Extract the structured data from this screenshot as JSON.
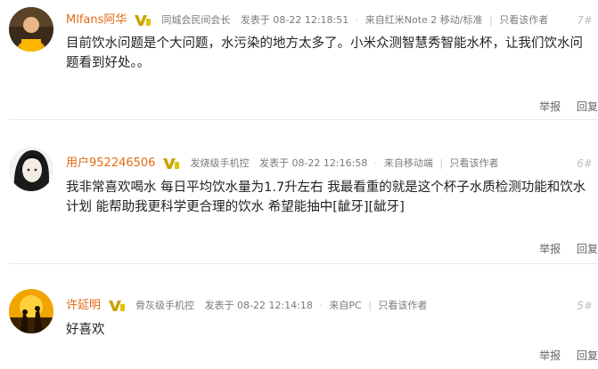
{
  "posts": [
    {
      "username": "Mlfans阿华",
      "title": "同城会民间会长",
      "posted": "发表于 08-22 12:18:51",
      "source": "来自红米Note 2 移动/标准",
      "only_author": "只看该作者",
      "floor": "7#",
      "content": "目前饮水问题是个大问题，水污染的地方太多了。小米众测智慧秀智能水杯，让我们饮水问题看到好处。。",
      "report": "举报",
      "reply": "回复"
    },
    {
      "username": "用户952246506",
      "title": "发烧级手机控",
      "posted": "发表于 08-22 12:16:58",
      "source": "来自移动端",
      "only_author": "只看该作者",
      "floor": "6#",
      "content": "我非常喜欢喝水 每日平均饮水量为1.7升左右 我最看重的就是这个杯子水质检测功能和饮水计划 能帮助我更科学更合理的饮水 希望能抽中[龇牙][龇牙]",
      "report": "举报",
      "reply": "回复"
    },
    {
      "username": "许延明",
      "title": "骨灰级手机控",
      "posted": "发表于 08-22 12:14:18",
      "source": "来自PC",
      "only_author": "只看该作者",
      "floor": "5#",
      "content": "好喜欢",
      "report": "举报",
      "reply": "回复"
    }
  ],
  "colors": {
    "username": "#e36a12",
    "badge": "#c9a400"
  }
}
